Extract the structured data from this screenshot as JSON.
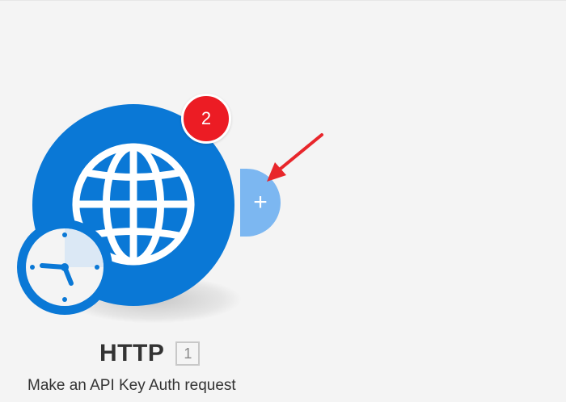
{
  "module": {
    "title": "HTTP",
    "id_badge": "1",
    "subtitle": "Make an API Key Auth request",
    "badge_count": "2",
    "add_label": "+",
    "icon": "globe-icon",
    "trigger_icon": "clock-icon"
  },
  "colors": {
    "background": "#f4f4f4",
    "module_blue": "#0a78d6",
    "add_handle": "#7cb7f1",
    "badge_red": "#ec1c24",
    "arrow_red": "#e8262b"
  }
}
